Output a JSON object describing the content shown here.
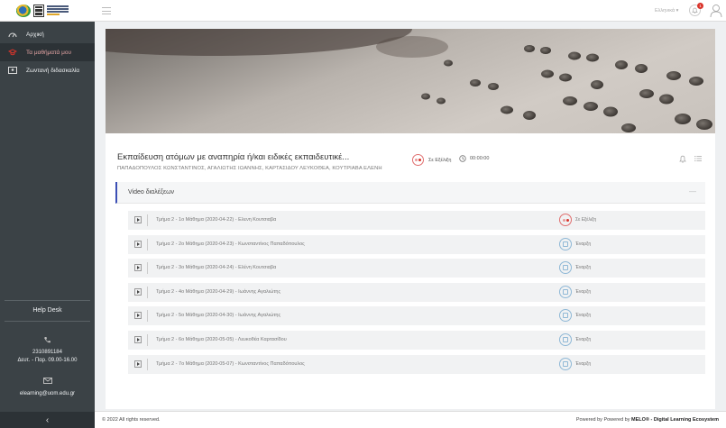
{
  "sidebar": {
    "nav": [
      {
        "label": "Αρχική",
        "icon": "dashboard-gauge-icon",
        "active": false
      },
      {
        "label": "Τα μαθήματά μου",
        "icon": "courses-icon",
        "active": true
      },
      {
        "label": "Ζωντανή διδασκαλία",
        "icon": "live-teaching-icon",
        "active": false
      }
    ],
    "helpdesk": {
      "title": "Help Desk",
      "phone": "2310891184",
      "hours": "Δευτ. - Παρ. 09.00-16.00",
      "email": "elearning@uom.edu.gr"
    },
    "collapse": "‹"
  },
  "topbar": {
    "language": "Ελληνικά ▾",
    "notifications_count": "1"
  },
  "course": {
    "title": "Εκπαίδευση ατόμων με αναπηρία ή/και ειδικές εκπαιδευτικέ...",
    "instructors": "ΠΑΠΑΔΟΠΟΥΛΟΣ ΚΩΝΣΤΑΝΤΙΝΟΣ, ΑΓΑΛΙΩΤΗΣ ΙΩΑΝΝΗΣ, ΚΑΡΤΑΣΙΔΟΥ ΛΕΥΚΟΘΕΑ, ΚΟΥΤΡΙΑΒΑ ΕΛΕΝΗ",
    "status": "Σε Εξέλιξη",
    "duration": "00:00:00"
  },
  "lectures": {
    "title": "Video διαλέξεων",
    "collapse": "—",
    "rows": [
      {
        "label": "Τμήμα 2 - 1ο Μάθημα (2020-04-22) - Ελενη Κουτσιαβα",
        "action": "Σε Εξέλιξη",
        "recording": true
      },
      {
        "label": "Τμήμα 2 - 2ο Μάθημα (2020-04-23) - Κωνσταντίνος Παπαδόπουλος",
        "action": "Έναρξη",
        "recording": false
      },
      {
        "label": "Τμήμα 2 - 3ο Μάθημα (2020-04-24) - Ελένη Κουτσιαβα",
        "action": "Έναρξη",
        "recording": false
      },
      {
        "label": "Τμήμα 2 - 4ο Μάθημα (2020-04-29) - Ιωάννης Αγαλιώτης",
        "action": "Έναρξη",
        "recording": false
      },
      {
        "label": "Τμήμα 2 - 5ο Μάθημα (2020-04-30) - Ιωάννης Αγαλιώτης",
        "action": "Έναρξη",
        "recording": false
      },
      {
        "label": "Τμήμα 2 - 6ο Μάθημα (2020-05-05) - Λευκοθέα Καρτασίδου",
        "action": "Έναρξη",
        "recording": false
      },
      {
        "label": "Τμήμα 2 - 7ο Μάθημα (2020-05-07) - Κωνσταντίνος Παπαδόπουλος",
        "action": "Έναρξη",
        "recording": false
      }
    ]
  },
  "footer": {
    "copyright": "© 2022 All rights reserved.",
    "powered_prefix": "Powered by Powered by",
    "powered_brand": "MELO® - Digital Learning Ecosystem"
  }
}
